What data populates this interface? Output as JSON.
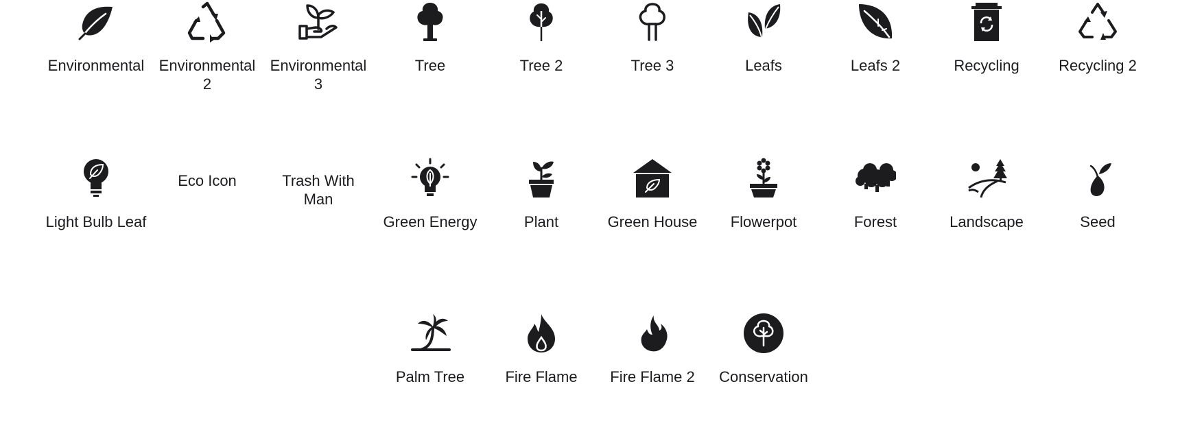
{
  "rows": [
    {
      "items": [
        {
          "label": "Environmental",
          "icon": "leaf-icon"
        },
        {
          "label": "Environmental 2",
          "icon": "recycle-triangle-icon"
        },
        {
          "label": "Environmental 3",
          "icon": "hand-plant-icon"
        },
        {
          "label": "Tree",
          "icon": "tree-icon"
        },
        {
          "label": "Tree 2",
          "icon": "tree-2-icon"
        },
        {
          "label": "Tree 3",
          "icon": "tree-3-icon"
        },
        {
          "label": "Leafs",
          "icon": "leafs-icon"
        },
        {
          "label": "Leafs 2",
          "icon": "leafs-2-icon"
        },
        {
          "label": "Recycling",
          "icon": "recycling-bin-icon"
        },
        {
          "label": "Recycling 2",
          "icon": "recycling-2-icon"
        }
      ]
    },
    {
      "items": [
        {
          "label": "Light Bulb Leaf",
          "icon": "light-bulb-leaf-icon"
        },
        {
          "label": "Eco Icon",
          "icon": "eco-icon"
        },
        {
          "label": "Trash With Man",
          "icon": "trash-with-man-icon"
        },
        {
          "label": "Green Energy",
          "icon": "green-energy-icon"
        },
        {
          "label": "Plant",
          "icon": "plant-icon"
        },
        {
          "label": "Green House",
          "icon": "green-house-icon"
        },
        {
          "label": "Flowerpot",
          "icon": "flowerpot-icon"
        },
        {
          "label": "Forest",
          "icon": "forest-icon"
        },
        {
          "label": "Landscape",
          "icon": "landscape-icon"
        },
        {
          "label": "Seed",
          "icon": "seed-icon"
        }
      ]
    },
    {
      "items": [
        {
          "label": "Palm Tree",
          "icon": "palm-tree-icon"
        },
        {
          "label": "Fire Flame",
          "icon": "fire-flame-icon"
        },
        {
          "label": "Fire Flame 2",
          "icon": "fire-flame-2-icon"
        },
        {
          "label": "Conservation",
          "icon": "conservation-icon"
        }
      ]
    }
  ],
  "colors": {
    "icon": "#1c1c1f",
    "text": "#1c1c1f",
    "background": "#ffffff"
  }
}
